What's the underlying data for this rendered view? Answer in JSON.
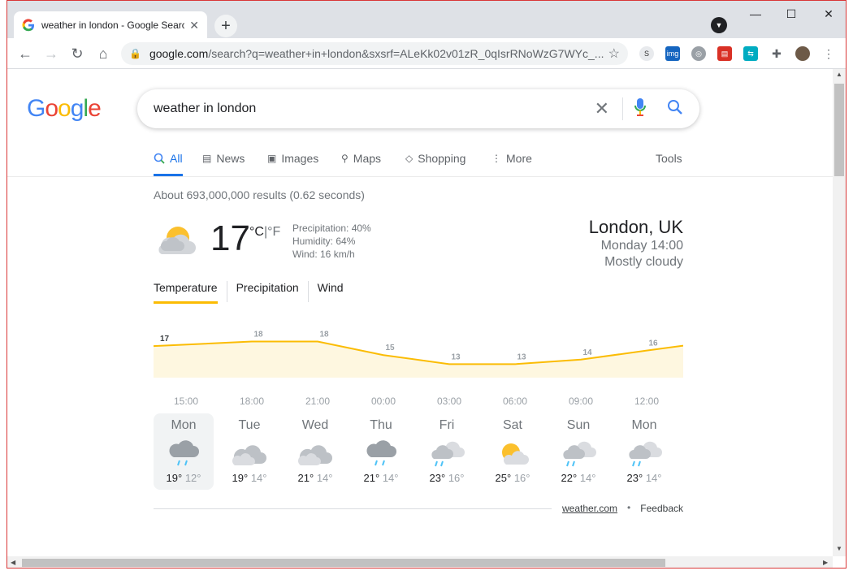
{
  "browser": {
    "tab_title": "weather in london - Google Search",
    "url_domain": "google.com",
    "url_path": "/search?q=weather+in+london&sxsrf=ALeKk02v01zR_0qIsrRNoWzG7WYc_..."
  },
  "google": {
    "logo": "Google",
    "query": "weather in london",
    "tabs": [
      {
        "label": "All",
        "icon": "search-icon"
      },
      {
        "label": "News",
        "icon": "news-icon"
      },
      {
        "label": "Images",
        "icon": "image-icon"
      },
      {
        "label": "Maps",
        "icon": "map-pin-icon"
      },
      {
        "label": "Shopping",
        "icon": "tag-icon"
      },
      {
        "label": "More",
        "icon": "more-vert-icon"
      }
    ],
    "tools_label": "Tools",
    "stats": "About 693,000,000 results (0.62 seconds)"
  },
  "weather": {
    "temp": "17",
    "unit_c": "°C",
    "unit_sep": "|",
    "unit_f": "°F",
    "precipitation": "Precipitation: 40%",
    "humidity": "Humidity: 64%",
    "wind": "Wind: 16 km/h",
    "location": "London, UK",
    "time": "Monday 14:00",
    "condition": "Mostly cloudy",
    "tabs": [
      "Temperature",
      "Precipitation",
      "Wind"
    ],
    "hourly_times": [
      "15:00",
      "18:00",
      "21:00",
      "00:00",
      "03:00",
      "06:00",
      "09:00",
      "12:00"
    ],
    "hourly_temps": [
      "17",
      "18",
      "18",
      "15",
      "13",
      "13",
      "14",
      "16"
    ],
    "days": [
      {
        "name": "Mon",
        "high": "19°",
        "low": "12°",
        "icon": "rain-icon"
      },
      {
        "name": "Tue",
        "high": "19°",
        "low": "14°",
        "icon": "cloudy-icon"
      },
      {
        "name": "Wed",
        "high": "21°",
        "low": "14°",
        "icon": "cloudy-icon"
      },
      {
        "name": "Thu",
        "high": "21°",
        "low": "14°",
        "icon": "rain-icon"
      },
      {
        "name": "Fri",
        "high": "23°",
        "low": "16°",
        "icon": "showers-icon"
      },
      {
        "name": "Sat",
        "high": "25°",
        "low": "16°",
        "icon": "partly-sunny-icon"
      },
      {
        "name": "Sun",
        "high": "22°",
        "low": "14°",
        "icon": "showers-icon"
      },
      {
        "name": "Mon",
        "high": "23°",
        "low": "14°",
        "icon": "showers-icon"
      }
    ],
    "source": "weather.com",
    "feedback": "Feedback"
  },
  "chart_data": {
    "type": "area",
    "x": [
      "15:00",
      "18:00",
      "21:00",
      "00:00",
      "03:00",
      "06:00",
      "09:00",
      "12:00"
    ],
    "values": [
      17,
      18,
      18,
      15,
      13,
      13,
      14,
      16
    ],
    "ylim": [
      10,
      19
    ]
  }
}
